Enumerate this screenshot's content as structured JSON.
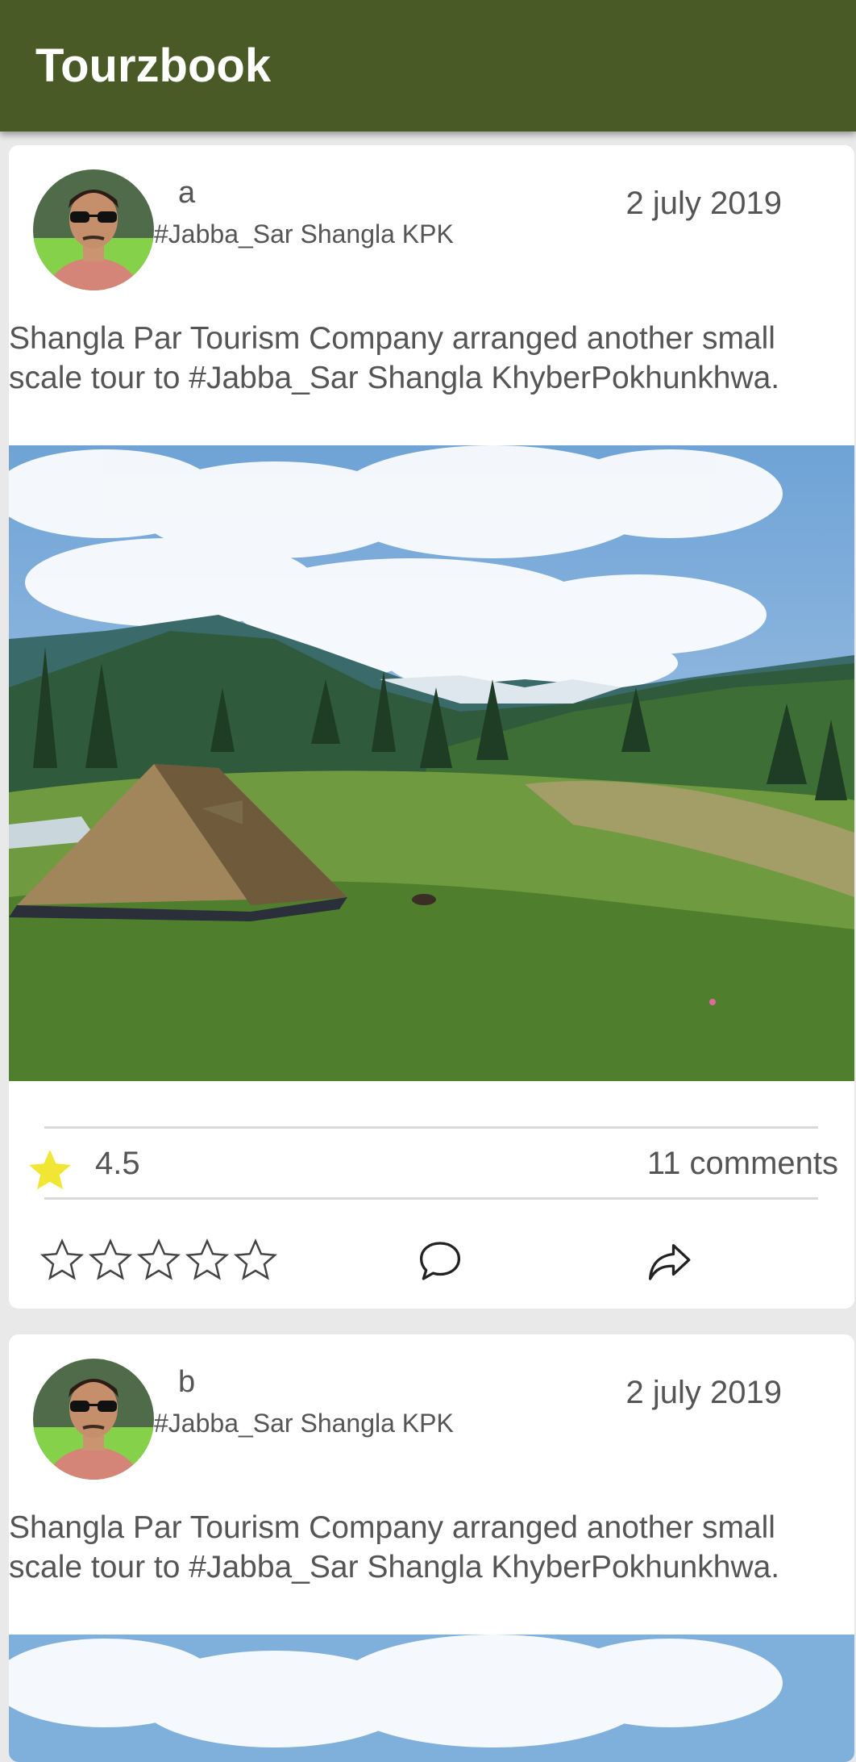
{
  "app": {
    "title": "Tourzbook"
  },
  "posts": [
    {
      "username": "a",
      "location": "#Jabba_Sar Shangla KPK",
      "date": "2 july 2019",
      "text": "Shangla Par Tourism Company arranged another small scale tour to #Jabba_Sar Shangla KhyberPokhunkhwa.",
      "rating": "4.5",
      "comments": "11 comments",
      "icons": {
        "rating": "star-filled-icon",
        "rate": "star-outline-icon",
        "comment": "comment-bubble-icon",
        "share": "share-arrow-icon"
      }
    },
    {
      "username": "b",
      "location": "#Jabba_Sar Shangla KPK",
      "date": "2 july 2019",
      "text": "Shangla Par Tourism Company arranged another small scale tour to #Jabba_Sar Shangla KhyberPokhunkhwa."
    }
  ],
  "colors": {
    "appbar": "#4a5a26",
    "background": "#e9e9e9",
    "text": "#555555",
    "rating_star": "#f2e635"
  }
}
